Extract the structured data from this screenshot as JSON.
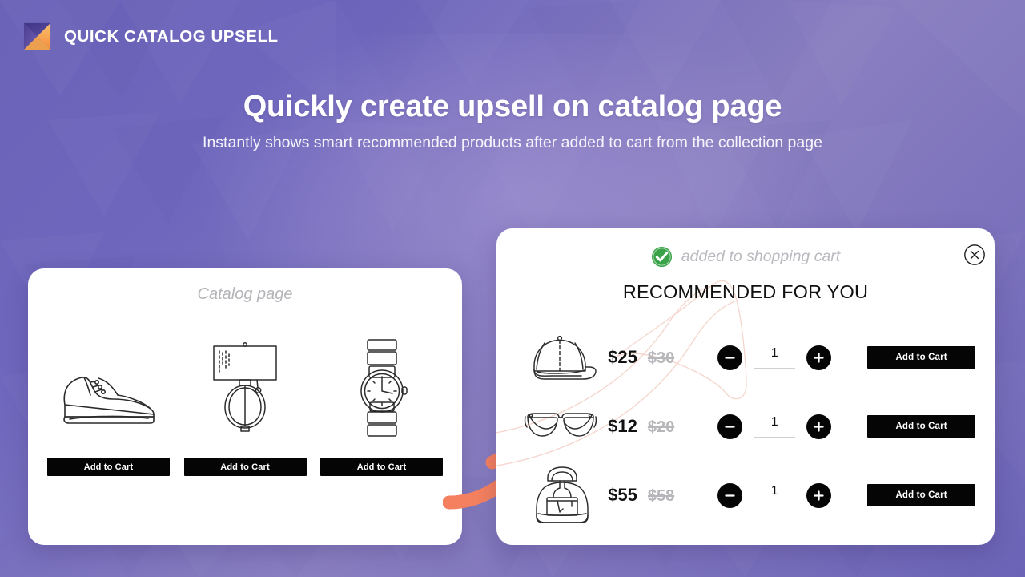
{
  "brand": {
    "logo_icon": "m-logo-icon",
    "title": "QUICK CATALOG UPSELL"
  },
  "hero": {
    "headline": "Quickly create upsell on catalog page",
    "subheadline": "Instantly shows smart recommended products after added to cart from the collection page"
  },
  "colors": {
    "background_purple": "#6a63b8",
    "background_purple_light": "#8a7fc0",
    "accent_orange": "#f4805f",
    "logo_orange": "#f5a33c",
    "success_green": "#34a047",
    "button_black": "#050505",
    "muted_grey": "#b5b5bb"
  },
  "catalog_panel": {
    "label": "Catalog page",
    "products": [
      {
        "art_icon": "sneaker-icon",
        "button_label": "Add to Cart"
      },
      {
        "art_icon": "table-lamp-icon",
        "button_label": "Add to Cart"
      },
      {
        "art_icon": "wristwatch-icon",
        "button_label": "Add to Cart"
      }
    ]
  },
  "upsell_panel": {
    "added_icon": "check-circle-icon",
    "added_text": "added to shopping cart",
    "recommended_title": "RECOMMENDED FOR YOU",
    "close_icon": "close-circle-icon",
    "minus_icon": "minus-icon",
    "plus_icon": "plus-icon",
    "items": [
      {
        "art_icon": "baseball-cap-icon",
        "price": "$25",
        "compare_price": "$30",
        "quantity": "1",
        "button_label": "Add to Cart"
      },
      {
        "art_icon": "eyeglasses-icon",
        "price": "$12",
        "compare_price": "$20",
        "quantity": "1",
        "button_label": "Add to Cart"
      },
      {
        "art_icon": "backpack-icon",
        "price": "$55",
        "compare_price": "$58",
        "quantity": "1",
        "button_label": "Add to Cart"
      }
    ]
  },
  "connector": {
    "arrow_icon": "curved-arrow-icon"
  }
}
